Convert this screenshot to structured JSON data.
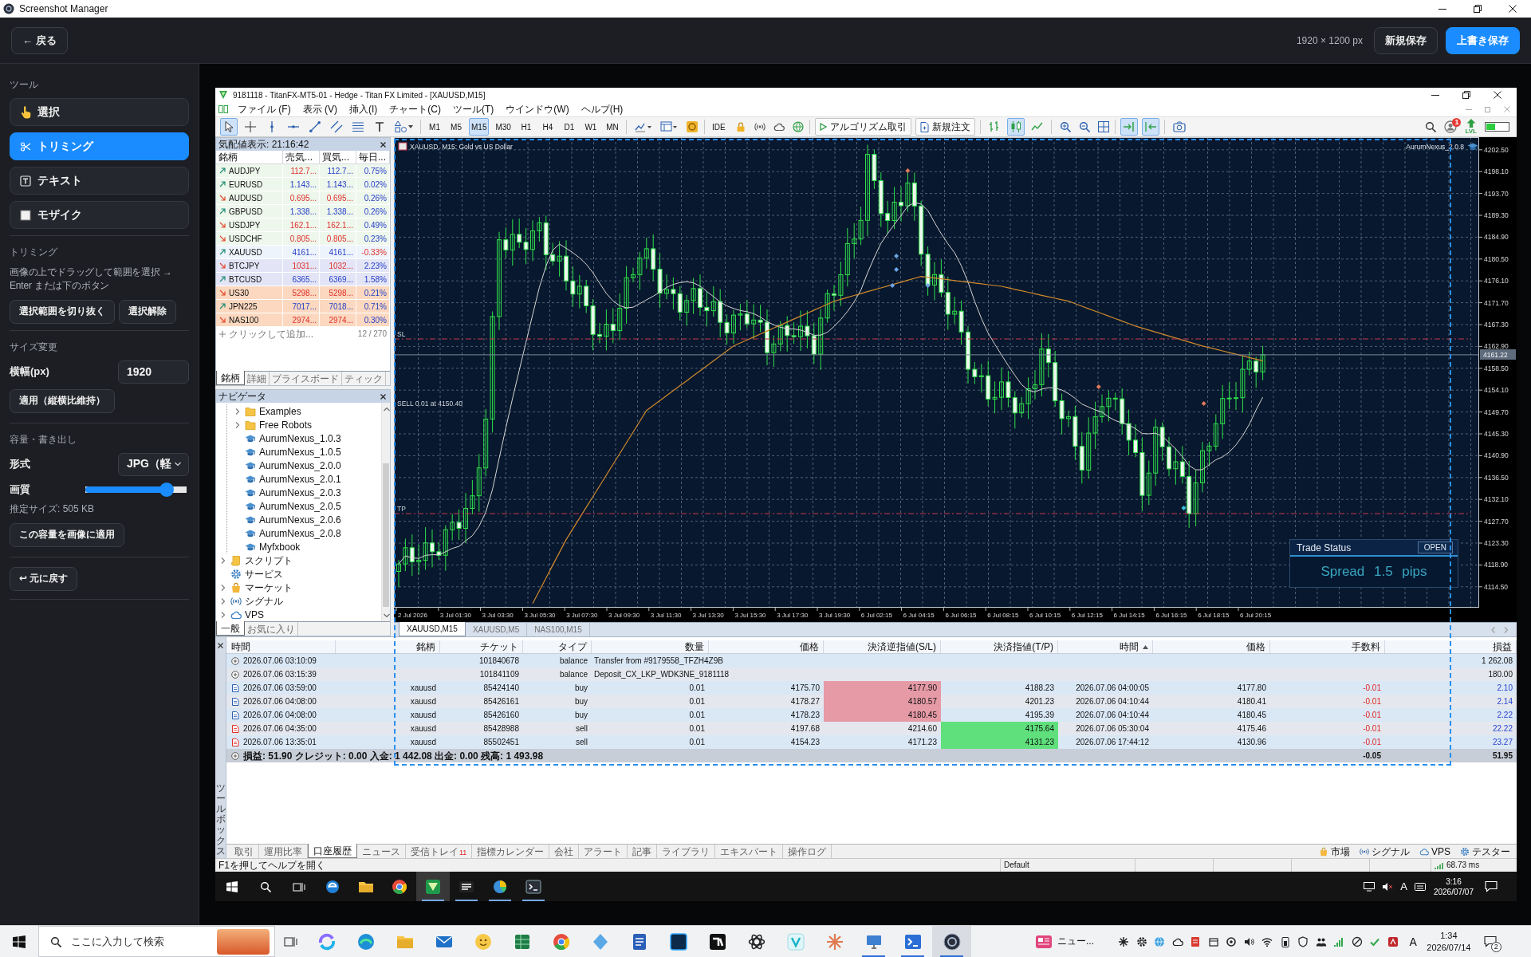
{
  "window": {
    "title": "Screenshot Manager"
  },
  "topbar": {
    "back": "← 戻る",
    "dimensions": "1920 × 1200 px",
    "buttons": [
      {
        "label": "新規保存",
        "primary": false
      },
      {
        "label": "上書き保存",
        "primary": true
      }
    ]
  },
  "sidebar": {
    "tools_heading": "ツール",
    "tools": [
      {
        "label": "選択",
        "selected": false
      },
      {
        "label": "トリミング",
        "selected": true
      },
      {
        "label": "テキスト",
        "selected": false
      },
      {
        "label": "モザイク",
        "selected": false
      }
    ],
    "trimming": {
      "heading": "トリミング",
      "hint": "画像の上でドラッグして範囲を選択 → Enter または下のボタン",
      "buttons": [
        "選択範囲を切り抜く",
        "選択解除"
      ]
    },
    "resize": {
      "heading": "サイズ変更",
      "width_label": "横幅(px)",
      "width_value": "1920",
      "apply": "適用（縦横比維持）"
    },
    "export": {
      "heading": "容量・書き出し",
      "format_label": "形式",
      "format_value": "JPG（軽",
      "quality": {
        "label": "画質",
        "level": 0.8
      },
      "estimate": "推定サイズ: 505 KB",
      "apply": "この容量を画像に適用"
    },
    "undo": "↩ 元に戻す"
  },
  "mt5": {
    "title": "9181118 - TitanFX-MT5-01 - Hedge - Titan FX Limited - [XAUUSD,M15]",
    "menu": [
      "ファイル (F)",
      "表示 (V)",
      "挿入(I)",
      "チャート(C)",
      "ツール(T)",
      "ウインドウ(W)",
      "ヘルプ(H)"
    ],
    "toolbar": {
      "drawing_tools": [
        {
          "selected": true
        },
        {
          "selected": false
        },
        {
          "selected": false
        },
        {
          "selected": false
        },
        {
          "selected": false
        },
        {
          "selected": false
        },
        {
          "selected": false
        },
        {
          "selected": false
        },
        {
          "selected": false
        }
      ],
      "timeframes": [
        {
          "label": "M1",
          "selected": false
        },
        {
          "label": "M5",
          "selected": false
        },
        {
          "label": "M15",
          "selected": true
        },
        {
          "label": "M30",
          "selected": false
        },
        {
          "label": "H1",
          "selected": false
        },
        {
          "label": "H4",
          "selected": false
        },
        {
          "label": "D1",
          "selected": false
        },
        {
          "label": "W1",
          "selected": false
        },
        {
          "label": "MN",
          "selected": false
        }
      ],
      "ide": "IDE",
      "algo_trading": "アルゴリズム取引",
      "new_order": "新規注文",
      "chart_types": [
        {
          "selected": false
        },
        {
          "selected": true
        },
        {
          "selected": false
        }
      ],
      "auto_scroll": {
        "on": true
      },
      "chart_shift": {
        "on": true
      },
      "notifications": "1",
      "level_label": "LVL"
    },
    "market_watch": {
      "title": "気配値表示: 21:16:42",
      "columns": [
        "銘柄",
        "売気...",
        "買気...",
        "毎日..."
      ],
      "rows": [
        {
          "symbol": "AUDJPY",
          "up": true,
          "bid": "112.7...",
          "bid_up": false,
          "ask": "112.7...",
          "ask_up": true,
          "change": "0.75%",
          "change_up": true,
          "color": "#eef7ec"
        },
        {
          "symbol": "EURUSD",
          "up": true,
          "bid": "1.143...",
          "bid_up": true,
          "ask": "1.143...",
          "ask_up": true,
          "change": "0.02%",
          "change_up": true,
          "color": "#eef7ec"
        },
        {
          "symbol": "AUDUSD",
          "up": false,
          "bid": "0.695...",
          "bid_up": false,
          "ask": "0.695...",
          "ask_up": false,
          "change": "0.26%",
          "change_up": true,
          "color": "#eef7ec"
        },
        {
          "symbol": "GBPUSD",
          "up": true,
          "bid": "1.338...",
          "bid_up": true,
          "ask": "1.338...",
          "ask_up": true,
          "change": "0.26%",
          "change_up": true,
          "color": "#eef7ec"
        },
        {
          "symbol": "USDJPY",
          "up": false,
          "bid": "162.1...",
          "bid_up": false,
          "ask": "162.1...",
          "ask_up": false,
          "change": "0.49%",
          "change_up": true,
          "color": "#eef7ec"
        },
        {
          "symbol": "USDCHF",
          "up": false,
          "bid": "0.805...",
          "bid_up": false,
          "ask": "0.805...",
          "ask_up": false,
          "change": "0.23%",
          "change_up": true,
          "color": "#eef7ec"
        },
        {
          "symbol": "XAUUSD",
          "up": true,
          "bid": "4161...",
          "bid_up": true,
          "ask": "4161...",
          "ask_up": true,
          "change": "-0.33%",
          "change_up": false,
          "color": "#eef4fb"
        },
        {
          "symbol": "BTCJPY",
          "up": false,
          "bid": "1031...",
          "bid_up": false,
          "ask": "1032...",
          "ask_up": false,
          "change": "2.23%",
          "change_up": true,
          "color": "#e3e5f7"
        },
        {
          "symbol": "BTCUSD",
          "up": true,
          "bid": "6365...",
          "bid_up": true,
          "ask": "6369...",
          "ask_up": true,
          "change": "1.58%",
          "change_up": true,
          "color": "#e3e5f7"
        },
        {
          "symbol": "US30",
          "up": false,
          "bid": "5298...",
          "bid_up": false,
          "ask": "5298...",
          "ask_up": false,
          "change": "0.21%",
          "change_up": true,
          "color": "#fbd8bf"
        },
        {
          "symbol": "JPN225",
          "up": true,
          "bid": "7017...",
          "bid_up": true,
          "ask": "7018...",
          "ask_up": true,
          "change": "0.71%",
          "change_up": true,
          "color": "#fbd8bf"
        },
        {
          "symbol": "NAS100",
          "up": false,
          "bid": "2974...",
          "bid_up": false,
          "ask": "2974...",
          "ask_up": false,
          "change": "0.30%",
          "change_up": true,
          "color": "#fbd8bf"
        }
      ],
      "add": "クリックして追加...",
      "count": "12 / 270",
      "tabs": [
        {
          "label": "銘柄",
          "selected": true
        },
        {
          "label": "詳細",
          "selected": false
        },
        {
          "label": "プライスボード",
          "selected": false
        },
        {
          "label": "ティック",
          "selected": false
        }
      ]
    },
    "navigator": {
      "title": "ナビゲータ",
      "items": [
        {
          "children": [
            {
              "label": "Examples",
              "kind": "folder",
              "expandable": true,
              "expanded": false
            },
            {
              "label": "Free Robots",
              "kind": "folder",
              "expandable": true,
              "expanded": false
            },
            {
              "label": "AurumNexus_1.0.3",
              "kind": "expert",
              "expandable": false
            },
            {
              "label": "AurumNexus_1.0.5",
              "kind": "expert",
              "expandable": false
            },
            {
              "label": "AurumNexus_2.0.0",
              "kind": "expert",
              "expandable": false
            },
            {
              "label": "AurumNexus_2.0.1",
              "kind": "expert",
              "expandable": false
            },
            {
              "label": "AurumNexus_2.0.3",
              "kind": "expert",
              "expandable": false
            },
            {
              "label": "AurumNexus_2.0.5",
              "kind": "expert",
              "expandable": false
            },
            {
              "label": "AurumNexus_2.0.6",
              "kind": "expert",
              "expandable": false
            },
            {
              "label": "AurumNexus_2.0.8",
              "kind": "expert",
              "expandable": false
            },
            {
              "label": "Myfxbook",
              "kind": "expert",
              "expandable": false
            }
          ]
        },
        {
          "label": "スクリプト",
          "kind": "scripts",
          "expandable": true,
          "expanded": false
        },
        {
          "label": "サービス",
          "kind": "services",
          "expandable": false
        },
        {
          "label": "マーケット",
          "kind": "market",
          "expandable": true,
          "expanded": false
        },
        {
          "label": "シグナル",
          "kind": "signals",
          "expandable": true,
          "expanded": false
        },
        {
          "label": "VPS",
          "kind": "vps",
          "expandable": true,
          "expanded": false
        }
      ],
      "tabs": [
        {
          "label": "一般",
          "selected": true
        },
        {
          "label": "お気に入り",
          "selected": false
        }
      ]
    },
    "chart": {
      "title": "XAUUSD, M15: Gold vs US Dollar",
      "expert": "AurumNexus_2.0.8",
      "price_axis": [
        "4202.50",
        "4198.10",
        "4193.70",
        "4189.30",
        "4184.90",
        "4180.50",
        "4176.10",
        "4171.70",
        "4167.30",
        "4162.90",
        "4158.50",
        "4154.10",
        "4149.70",
        "4145.30",
        "4140.90",
        "4136.50",
        "4132.10",
        "4127.70",
        "4123.30",
        "4118.90",
        "4114.50"
      ],
      "current_price": "4161.22",
      "time_axis": [
        "2 Jul 2026",
        "3 Jul 01:30",
        "3 Jul 03:30",
        "3 Jul 05:30",
        "3 Jul 07:30",
        "3 Jul 09:30",
        "3 Jul 11:30",
        "3 Jul 13:30",
        "3 Jul 15:30",
        "3 Jul 17:30",
        "3 Jul 19:30",
        "6 Jul 02:15",
        "6 Jul 04:15",
        "6 Jul 06:15",
        "6 Jul 08:15",
        "6 Jul 10:15",
        "6 Jul 12:15",
        "6 Jul 14:15",
        "6 Jul 16:15",
        "6 Jul 18:15",
        "6 Jul 20:15"
      ],
      "line_labels": [
        "SL",
        "SELL 0.01 at 4150.40",
        "TP"
      ],
      "trade_status": {
        "title": "Trade Status",
        "state": "OPEN",
        "spread": "Spread 1.5 pips"
      },
      "tabs": [
        {
          "label": "XAUUSD,M15",
          "selected": true
        },
        {
          "label": "XAUUSD,M5",
          "selected": false
        },
        {
          "label": "NAS100,M15",
          "selected": false
        }
      ]
    },
    "toolbox": {
      "title": "ツールボックス",
      "columns": [
        {
          "label": "時間",
          "sorted": false
        },
        {
          "label": "銘柄",
          "sorted": false
        },
        {
          "label": "チケット",
          "sorted": false
        },
        {
          "label": "タイプ",
          "sorted": false
        },
        {
          "label": "数量",
          "sorted": false
        },
        {
          "label": "価格",
          "sorted": false
        },
        {
          "label": "決済逆指値(S/L)",
          "sorted": false
        },
        {
          "label": "決済指値(T/P)",
          "sorted": false
        },
        {
          "label": "時間",
          "sorted": true
        },
        {
          "label": "価格",
          "sorted": false
        },
        {
          "label": "手数料",
          "sorted": false
        },
        {
          "label": "損益",
          "sorted": false
        }
      ],
      "rows": [
        {
          "kind": "balance",
          "time": "2026.07.06 03:10:09",
          "ticket": "101840678",
          "type": "balance",
          "comment": "Transfer from #9179558_TFZH4Z9B",
          "profit": "1 262.08"
        },
        {
          "kind": "balance",
          "time": "2026.07.06 03:15:39",
          "ticket": "101841109",
          "type": "balance",
          "comment": "Deposit_CX_LKP_WDK3NE_9181118",
          "profit": "180.00"
        },
        {
          "kind": "buy",
          "time": "2026.07.06 03:59:00",
          "symbol": "xauusd",
          "ticket": "85424140",
          "type": "buy",
          "volume": "0.01",
          "open_price": "4175.70",
          "sl": "4177.90",
          "sl_hit": true,
          "tp": "4188.23",
          "tp_hit": false,
          "close_time": "2026.07.06 04:00:05",
          "close_price": "4177.80",
          "commission": "-0.01",
          "profit": "2.10"
        },
        {
          "kind": "buy",
          "time": "2026.07.06 04:08:00",
          "symbol": "xauusd",
          "ticket": "85426161",
          "type": "buy",
          "volume": "0.01",
          "open_price": "4178.27",
          "sl": "4180.57",
          "sl_hit": true,
          "tp": "4201.23",
          "tp_hit": false,
          "close_time": "2026.07.06 04:10:44",
          "close_price": "4180.41",
          "commission": "-0.01",
          "profit": "2.14"
        },
        {
          "kind": "buy",
          "time": "2026.07.06 04:08:00",
          "symbol": "xauusd",
          "ticket": "85426160",
          "type": "buy",
          "volume": "0.01",
          "open_price": "4178.23",
          "sl": "4180.45",
          "sl_hit": true,
          "tp": "4195.39",
          "tp_hit": false,
          "close_time": "2026.07.06 04:10:44",
          "close_price": "4180.45",
          "commission": "-0.01",
          "profit": "2.22"
        },
        {
          "kind": "sell",
          "time": "2026.07.06 04:35:00",
          "symbol": "xauusd",
          "ticket": "85428988",
          "type": "sell",
          "volume": "0.01",
          "open_price": "4197.68",
          "sl": "4214.60",
          "sl_hit": false,
          "tp": "4175.64",
          "tp_hit": true,
          "close_time": "2026.07.06 05:30:04",
          "close_price": "4175.46",
          "commission": "-0.01",
          "profit": "22.22"
        },
        {
          "kind": "sell",
          "time": "2026.07.06 13:35:01",
          "symbol": "xauusd",
          "ticket": "85502451",
          "type": "sell",
          "volume": "0.01",
          "open_price": "4154.23",
          "sl": "4171.23",
          "sl_hit": false,
          "tp": "4131.23",
          "tp_hit": true,
          "close_time": "2026.07.06 17:44:12",
          "close_price": "4130.96",
          "commission": "-0.01",
          "profit": "23.27"
        }
      ],
      "summary": {
        "text": "損益: 51.90 クレジット: 0.00 入金: 1 442.08 出金: 0.00 残高: 1 493.98",
        "commission": "-0.05",
        "profit": "51.95"
      },
      "tabs": [
        {
          "label": "取引",
          "selected": false
        },
        {
          "label": "運用比率",
          "selected": false
        },
        {
          "label": "口座履歴",
          "selected": true
        },
        {
          "label": "ニュース",
          "selected": false
        },
        {
          "label": "受信トレイ",
          "selected": false,
          "badge": "11"
        },
        {
          "label": "指標カレンダー",
          "selected": false
        },
        {
          "label": "会社",
          "selected": false
        },
        {
          "label": "アラート",
          "selected": false
        },
        {
          "label": "記事",
          "selected": false
        },
        {
          "label": "ライブラリ",
          "selected": false
        },
        {
          "label": "エキスパート",
          "selected": false
        },
        {
          "label": "操作ログ",
          "selected": false
        }
      ],
      "services": [
        "市場",
        "シグナル",
        "VPS",
        "テスター"
      ]
    },
    "status_bar": {
      "help": "F1を押してヘルプを開く",
      "profile": "Default",
      "ping": "68.73 ms"
    },
    "taskbar": {
      "apps": [
        {
          "running": false,
          "active": false
        },
        {
          "running": false,
          "active": false
        },
        {
          "running": false,
          "active": false
        },
        {
          "running": true,
          "active": true
        },
        {
          "running": true,
          "active": false
        },
        {
          "running": true,
          "active": false
        },
        {
          "running": true,
          "active": false
        }
      ],
      "ime": "A",
      "time": "3:16",
      "date": "2026/07/07"
    }
  },
  "taskbar": {
    "search": {
      "placeholder": "ここに入力して検索"
    },
    "apps": [
      {
        "running": false,
        "active": false
      },
      {
        "running": false,
        "active": false
      },
      {
        "running": false,
        "active": false
      },
      {
        "running": false,
        "active": false
      },
      {
        "running": false,
        "active": false
      },
      {
        "running": false,
        "active": false
      },
      {
        "running": false,
        "active": false
      },
      {
        "running": false,
        "active": false
      },
      {
        "running": false,
        "active": false
      },
      {
        "running": false,
        "active": false
      },
      {
        "running": false,
        "active": false
      },
      {
        "running": false,
        "active": false
      },
      {
        "running": false,
        "active": false
      },
      {
        "running": false,
        "active": false
      },
      {
        "running": true,
        "active": false
      },
      {
        "running": true,
        "active": false
      },
      {
        "running": true,
        "active": true
      }
    ],
    "news": "ニュー...",
    "ime": "A",
    "time": "1:34",
    "date": "2026/07/14",
    "notifications": "2"
  }
}
